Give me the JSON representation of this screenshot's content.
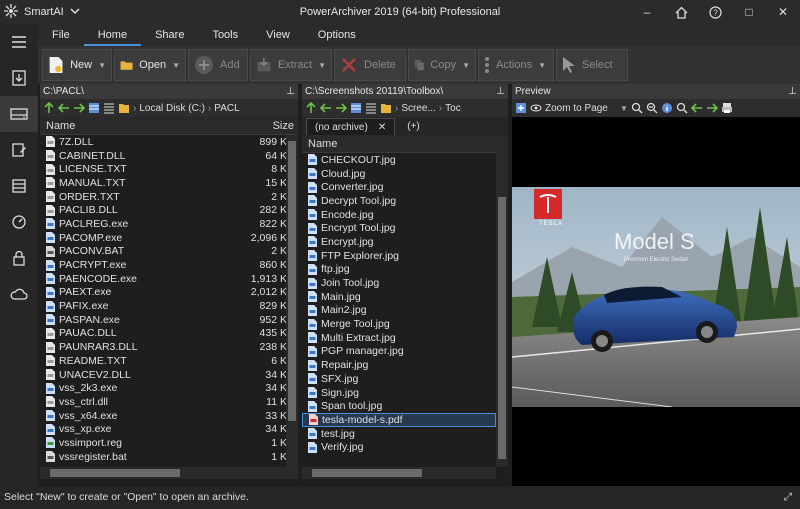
{
  "titlebar": {
    "app_name": "SmartAI",
    "title": "PowerArchiver 2019 (64-bit) Professional",
    "min": "–",
    "home": "⌂",
    "help": "?",
    "max": "□",
    "close": "✕"
  },
  "menu": [
    "File",
    "Home",
    "Share",
    "Tools",
    "View",
    "Options"
  ],
  "ribbon": {
    "new": "New",
    "open": "Open",
    "add": "Add",
    "extract": "Extract",
    "delete": "Delete",
    "copy": "Copy",
    "actions": "Actions",
    "select": "Select"
  },
  "left_pane": {
    "path": "C:\\PACL\\",
    "drive": "Local Disk (C:)",
    "folder": "PACL",
    "col_name": "Name",
    "col_size": "Size",
    "files": [
      {
        "name": "7Z.DLL",
        "size": "899 KB"
      },
      {
        "name": "CABINET.DLL",
        "size": "64 KB"
      },
      {
        "name": "LICENSE.TXT",
        "size": "8 KB"
      },
      {
        "name": "MANUAL.TXT",
        "size": "15 KB"
      },
      {
        "name": "ORDER.TXT",
        "size": "2 KB"
      },
      {
        "name": "PACLIB.DLL",
        "size": "282 KB"
      },
      {
        "name": "PACLREG.exe",
        "size": "822 KB"
      },
      {
        "name": "PACOMP.exe",
        "size": "2,096 KB"
      },
      {
        "name": "PACONV.BAT",
        "size": "2 KB"
      },
      {
        "name": "PACRYPT.exe",
        "size": "860 KB"
      },
      {
        "name": "PAENCODE.exe",
        "size": "1,913 KB"
      },
      {
        "name": "PAEXT.exe",
        "size": "2,012 KB"
      },
      {
        "name": "PAFIX.exe",
        "size": "829 KB"
      },
      {
        "name": "PASPAN.exe",
        "size": "952 KB"
      },
      {
        "name": "PAUAC.DLL",
        "size": "435 KB"
      },
      {
        "name": "PAUNRAR3.DLL",
        "size": "238 KB"
      },
      {
        "name": "README.TXT",
        "size": "6 KB"
      },
      {
        "name": "UNACEV2.DLL",
        "size": "34 KB"
      },
      {
        "name": "vss_2k3.exe",
        "size": "34 KB"
      },
      {
        "name": "vss_ctrl.dll",
        "size": "11 KB"
      },
      {
        "name": "vss_x64.exe",
        "size": "33 KB"
      },
      {
        "name": "vss_xp.exe",
        "size": "34 KB"
      },
      {
        "name": "vssimport.reg",
        "size": "1 KB"
      },
      {
        "name": "vssregister.bat",
        "size": "1 KB"
      }
    ]
  },
  "mid_pane": {
    "path": "C:\\Screenshots 20119\\Toolbox\\",
    "crumb1": "Scree...",
    "crumb2": "Toc",
    "tab_archive": "(no archive)",
    "tab_close": "✕",
    "tab_add": "(+)",
    "col_name": "Name",
    "files": [
      "CHECKOUT.jpg",
      "Cloud.jpg",
      "Converter.jpg",
      "Decrypt Tool.jpg",
      "Encode.jpg",
      "Encrypt Tool.jpg",
      "Encrypt.jpg",
      "FTP Explorer.jpg",
      "ftp.jpg",
      "Join Tool.jpg",
      "Main.jpg",
      "Main2.jpg",
      "Merge Tool.jpg",
      "Multi Extract.jpg",
      "PGP manager.jpg",
      "Repair.jpg",
      "SFX.jpg",
      "Sign.jpg",
      "Span tool.jpg",
      "tesla-model-s.pdf",
      "test.jpg",
      "Verify.jpg"
    ],
    "selected": "tesla-model-s.pdf"
  },
  "preview": {
    "header": "Preview",
    "zoom": "Zoom to Page",
    "brand": "TESLA",
    "model": "Model S",
    "tagline": "Premium Electric Sedan"
  },
  "statusbar": {
    "text": "Select \"New\" to create or \"Open\" to open an archive."
  }
}
